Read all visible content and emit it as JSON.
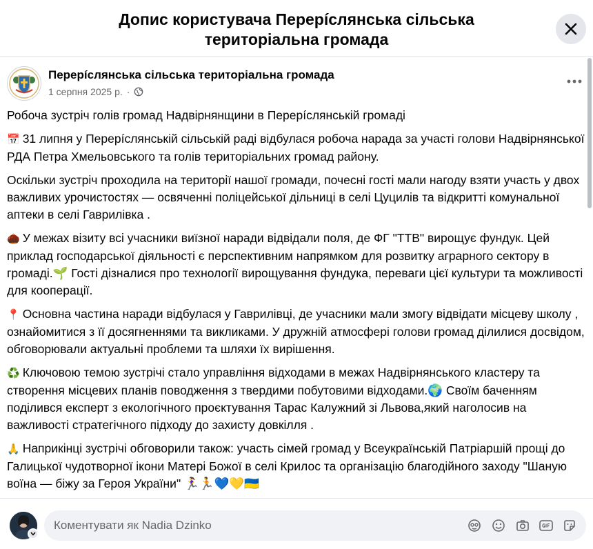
{
  "modal": {
    "title_line1": "Допис користувача Перерíслянська сільська",
    "title_line2": "територіальна громада"
  },
  "post": {
    "page_name": "Перерíслянська сільська територіальна громада",
    "date": "1 серпня 2025 р.",
    "dot": "·",
    "paragraphs": [
      {
        "emoji": "",
        "text": "Робоча зустріч голів громад Надвірнянщини в Перерíслянській громаді"
      },
      {
        "emoji": "📅",
        "text": "31 липня у Перерíслянській сільській раді відбулася робоча нарада за участі голови Надвірнянської РДА Петра Хмельовського та голів територіальних громад району."
      },
      {
        "emoji": "",
        "text": "Оскільки зустріч проходила на території нашої громади, почесні гості мали нагоду взяти участь у двох важливих урочистостях — освяченні поліцейської дільниці в селі Цуцилів та відкритті комунальної аптеки в селі Гаврилівка ."
      },
      {
        "emoji": "🌰",
        "text": "У межах візиту всі учасники виїзної наради відвідали поля, де ФГ \"ТТВ\" вирощує фундук. Цей приклад господарської діяльності є перспективним напрямком для розвитку аграрного сектору в громаді.🌱 Гості дізналися про технології вирощування фундука, переваги цієї культури та можливості для кооперації."
      },
      {
        "emoji": "📍",
        "text": "Основна частина наради відбулася у Гаврилівці, де учасники мали змогу відвідати місцеву школу , ознайомитися з її досягненнями та викликами. У дружній атмосфері голови громад ділилися досвідом, обговорювали актуальні проблеми та шляхи їх вирішення."
      },
      {
        "emoji": "♻️",
        "text": "Ключовою темою зустрічі стало управління відходами в межах Надвірнянського кластеру та створення місцевих планів поводження з твердими побутовими відходами.🌍 Своїм баченням поділився експерт з екологічного проєктування Тарас Калужний зі Львова,який наголосив на важливості стратегічного підходу до захисту довкілля ."
      },
      {
        "emoji": "🙏",
        "text": "Наприкінці зустрічі обговорили також: участь сімей громад у Всеукраїнській Патріаршій прощі до Галицької чудотворної ікони Матері Божої в селі Крилос та організацію благодійного заходу \"Шаную воїна — біжу за Героя України\" 🏃‍♀️🏃💙💛🇺🇦"
      }
    ]
  },
  "composer": {
    "placeholder": "Коментувати як Nadia Dzinko",
    "tools": [
      "avatar-sticker-icon",
      "emoji-icon",
      "camera-icon",
      "gif-icon",
      "sticker-icon"
    ]
  },
  "colors": {
    "text_primary": "#050505",
    "text_secondary": "#65676b",
    "input_bg": "#f0f2f5",
    "close_bg": "#e4e6eb",
    "divider": "#e4e6eb"
  }
}
